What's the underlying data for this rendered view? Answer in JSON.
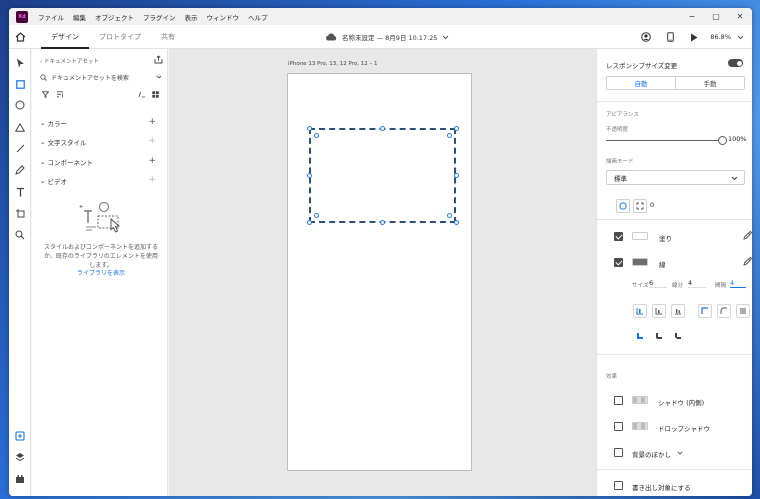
{
  "app": {
    "logo": "Xd",
    "menu": [
      "ファイル",
      "編集",
      "オブジェクト",
      "プラグイン",
      "表示",
      "ウィンドウ",
      "ヘルプ"
    ],
    "window_controls": [
      "−",
      "▢",
      "✕"
    ]
  },
  "toolbar": {
    "tabs": [
      {
        "label": "デザイン",
        "active": true
      },
      {
        "label": "プロトタイプ",
        "active": false
      },
      {
        "label": "共有",
        "active": false
      }
    ],
    "doc_title": "名称未設定 — 8月9日 10.17.25",
    "zoom": "86.8%"
  },
  "assets": {
    "breadcrumb": "ドキュメントアセット",
    "search_placeholder": "ドキュメントアセットを検索",
    "sections": [
      {
        "label": "カラー",
        "plus_enabled": true
      },
      {
        "label": "文字スタイル",
        "plus_enabled": false
      },
      {
        "label": "コンポーネント",
        "plus_enabled": true
      },
      {
        "label": "ビデオ",
        "plus_enabled": false
      }
    ],
    "empty_text": "スタイルおよびコンポーネントを追加するか、既存のライブラリのエレメントを使用します。",
    "library_link": "ライブラリを表示"
  },
  "canvas": {
    "artboard_label": "iPhone 13 Pro, 13, 12 Pro, 12 – 1"
  },
  "props": {
    "responsive_label": "レスポンシブサイズ変更",
    "responsive_on": true,
    "mode_auto": "自動",
    "mode_manual": "手動",
    "appearance_label": "アピアランス",
    "opacity_label": "不透明度",
    "opacity_value": "100%",
    "opacity": 1.0,
    "blend_label": "描画モード",
    "blend_value": "標準",
    "corner_radius": "0",
    "fill_label": "塗り",
    "fill_color": "#ffffff",
    "fill_checked": true,
    "stroke_label": "線",
    "stroke_color": "#6e6e6e",
    "stroke_checked": true,
    "size_label": "サイズ",
    "size_value": "6",
    "dash_label": "線分",
    "dash_value": "4",
    "gap_label": "間隔",
    "gap_value": "4",
    "effects_label": "効果",
    "inner_shadow_label": "シャドウ (内側)",
    "drop_shadow_label": "ドロップシャドウ",
    "bg_blur_label": "背景のぼかし",
    "export_label": "書き出し対象にする",
    "accent_color": "#1473e6"
  }
}
